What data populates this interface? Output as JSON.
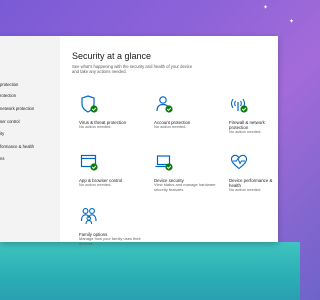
{
  "page": {
    "title": "Security at a glance",
    "subtitle": "See what's happening with the security and health of your device and take any actions needed."
  },
  "sidebar": {
    "items": [
      {
        "label": "protection"
      },
      {
        "label": "rotection"
      },
      {
        "label": "network protection"
      },
      {
        "label": "ser control"
      },
      {
        "label": "ity"
      },
      {
        "label": "formance & health"
      },
      {
        "label": "ns"
      }
    ]
  },
  "cards": [
    {
      "title": "Virus & threat protection",
      "status": "No action needed.",
      "icon": "shield-icon"
    },
    {
      "title": "Account protection",
      "status": "No action needed.",
      "icon": "person-icon"
    },
    {
      "title": "Firewall & network protection",
      "status": "No action needed.",
      "icon": "wifi-icon"
    },
    {
      "title": "App & browser control",
      "status": "No action needed.",
      "icon": "browser-window-icon"
    },
    {
      "title": "Device security",
      "status": "View status and manage hardware security features",
      "icon": "laptop-icon"
    },
    {
      "title": "Device performance & health",
      "status": "No action needed.",
      "icon": "heart-pulse-icon"
    },
    {
      "title": "Family options",
      "status": "Manage how your family uses their devices.",
      "icon": "family-icon"
    }
  ],
  "colors": {
    "accent": "#0067c0",
    "ok": "#0f7b0f",
    "background": "#ffffff"
  }
}
